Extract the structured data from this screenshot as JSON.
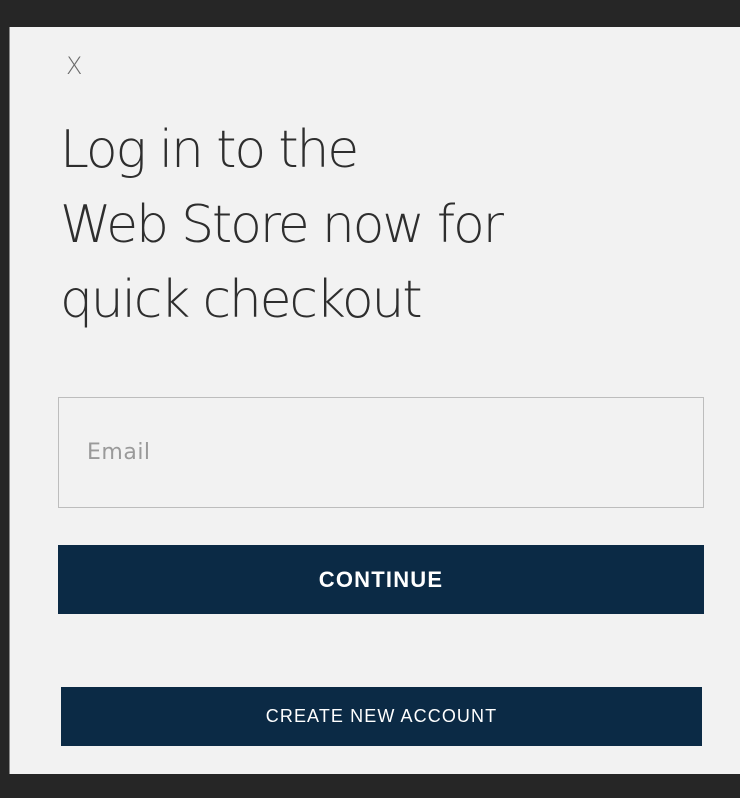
{
  "modal": {
    "close_label": "X",
    "headline": {
      "line1": "Log in to the",
      "line2": "Web Store now for",
      "line3": "quick checkout"
    },
    "email": {
      "placeholder": "Email",
      "value": ""
    },
    "continue_label": "CONTINUE",
    "create_account_label": "CREATE NEW ACCOUNT"
  }
}
